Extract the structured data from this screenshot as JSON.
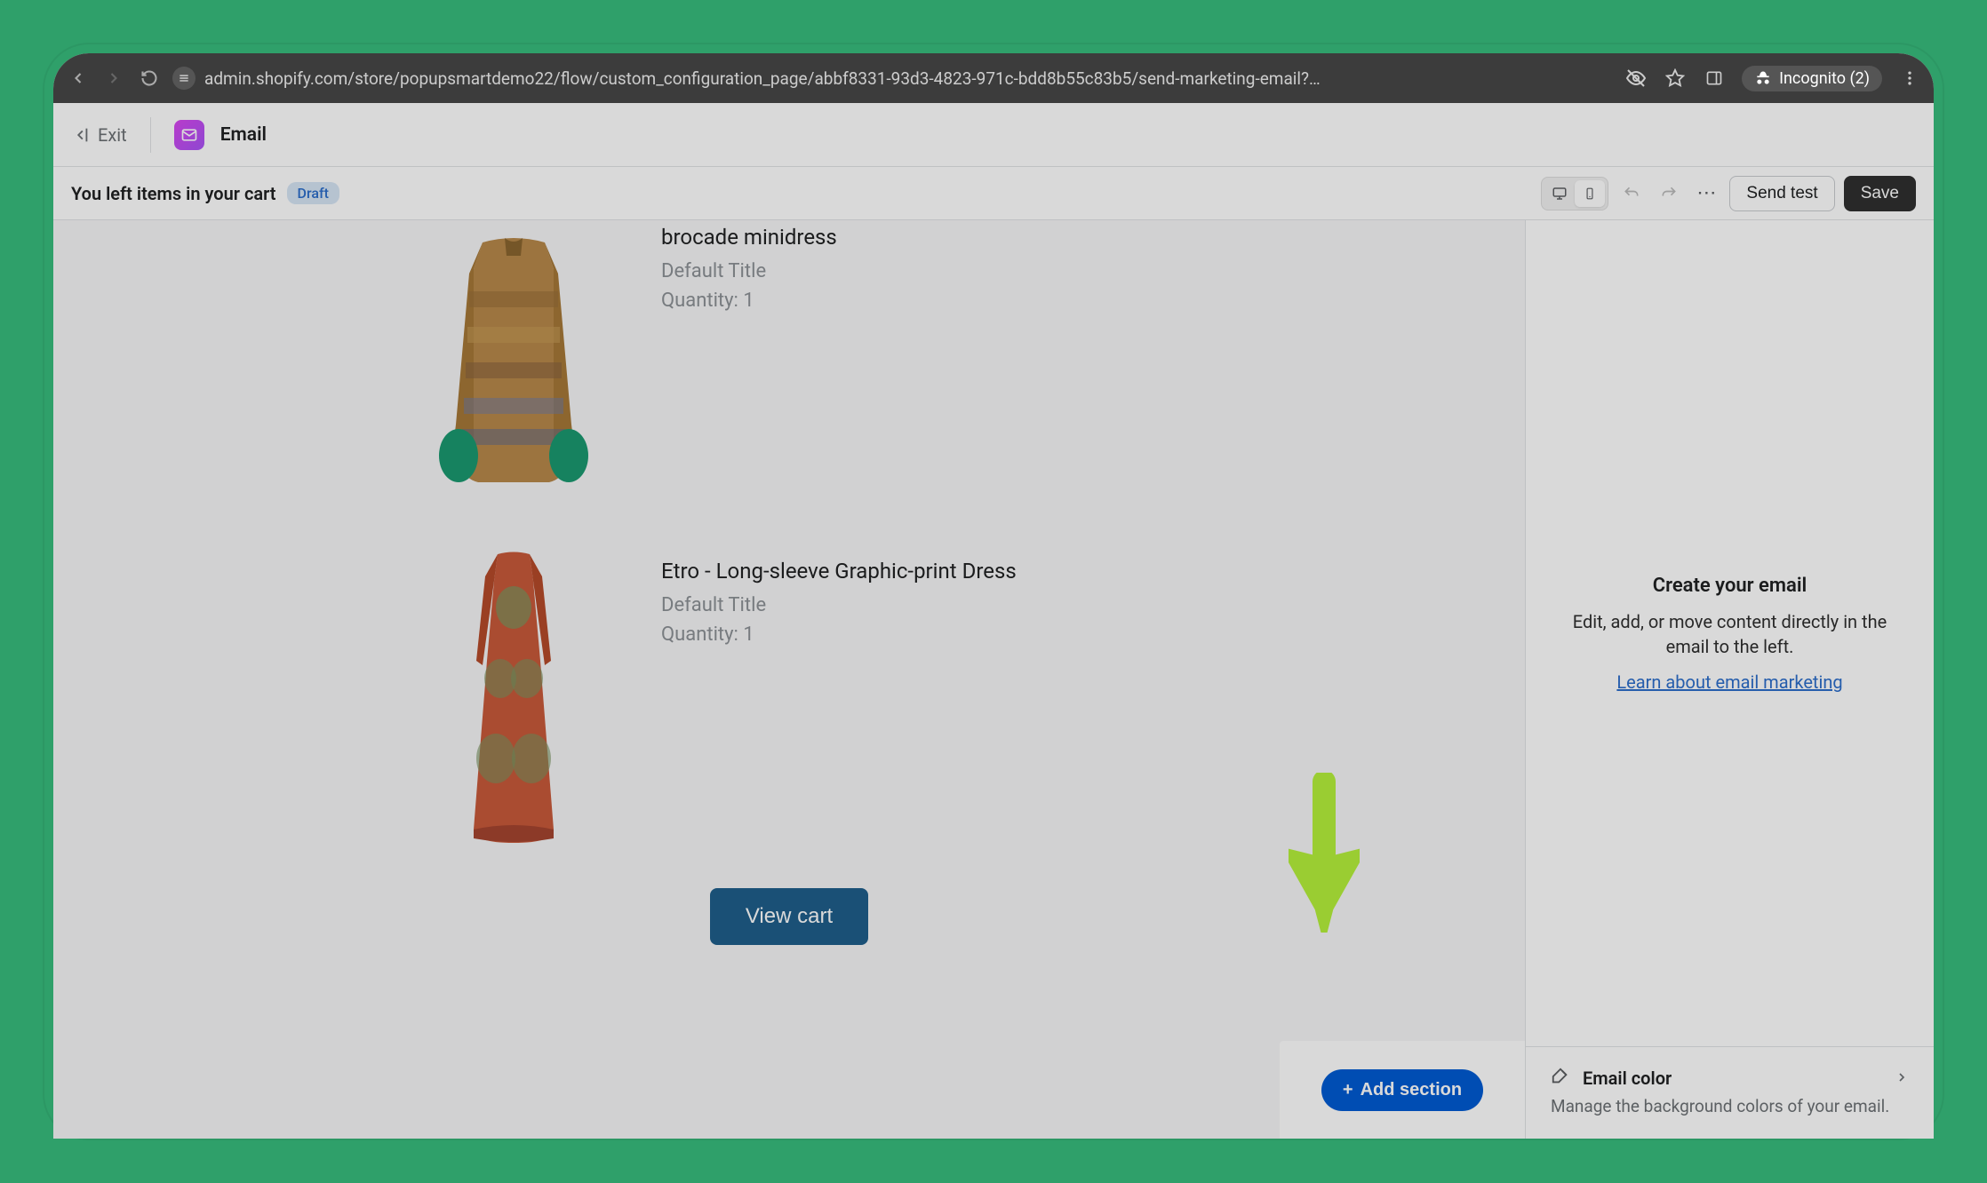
{
  "browser": {
    "url": "admin.shopify.com/store/popupsmartdemo22/flow/custom_configuration_page/abbf8331-93d3-4823-971c-bdd8b55c83b5/send-marketing-email?…",
    "incognito_label": "Incognito (2)"
  },
  "header": {
    "exit": "Exit",
    "app_name": "Email"
  },
  "subheader": {
    "title": "You left items in your cart",
    "badge": "Draft",
    "send_test": "Send test",
    "save": "Save"
  },
  "products": [
    {
      "title": "brocade minidress",
      "variant": "Default Title",
      "qty": "Quantity: 1"
    },
    {
      "title": "Etro - Long-sleeve Graphic-print Dress",
      "variant": "Default Title",
      "qty": "Quantity: 1"
    }
  ],
  "cart": {
    "view_cart": "View cart"
  },
  "add_section": {
    "label": "Add section"
  },
  "sidepanel": {
    "title": "Create your email",
    "desc": "Edit, add, or move content directly in the email to the left.",
    "link": "Learn about email marketing",
    "footer_title": "Email color",
    "footer_desc": "Manage the background colors of your email."
  }
}
